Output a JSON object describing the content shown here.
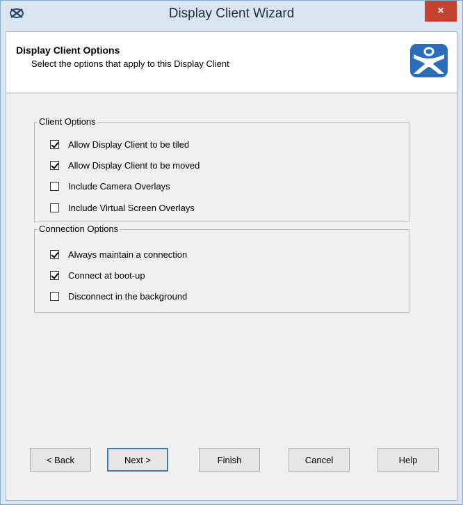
{
  "window": {
    "title": "Display Client Wizard",
    "close_glyph": "×",
    "app_icon": "wizard-app-icon",
    "close_color": "#c64230"
  },
  "header": {
    "title": "Display Client Options",
    "subtitle": "Select the options that apply to this Display Client",
    "logo_icon": "terminal-services-logo-icon"
  },
  "client_options": {
    "legend": "Client Options",
    "items": [
      {
        "label": "Allow Display Client to be tiled",
        "checked": true
      },
      {
        "label": "Allow Display Client to be moved",
        "checked": true
      },
      {
        "label": "Include Camera Overlays",
        "checked": false
      },
      {
        "label": "Include Virtual Screen Overlays",
        "checked": false
      }
    ]
  },
  "connection_options": {
    "legend": "Connection Options",
    "items": [
      {
        "label": "Always maintain a connection",
        "checked": true
      },
      {
        "label": "Connect at boot-up",
        "checked": true
      },
      {
        "label": "Disconnect in the background",
        "checked": false
      }
    ]
  },
  "buttons": {
    "back": "< Back",
    "next": "Next >",
    "finish": "Finish",
    "cancel": "Cancel",
    "help": "Help"
  },
  "colors": {
    "frame": "#d9e6f2",
    "dialog_bg": "#f0f0f0",
    "logo_blue": "#2a6dbb"
  }
}
